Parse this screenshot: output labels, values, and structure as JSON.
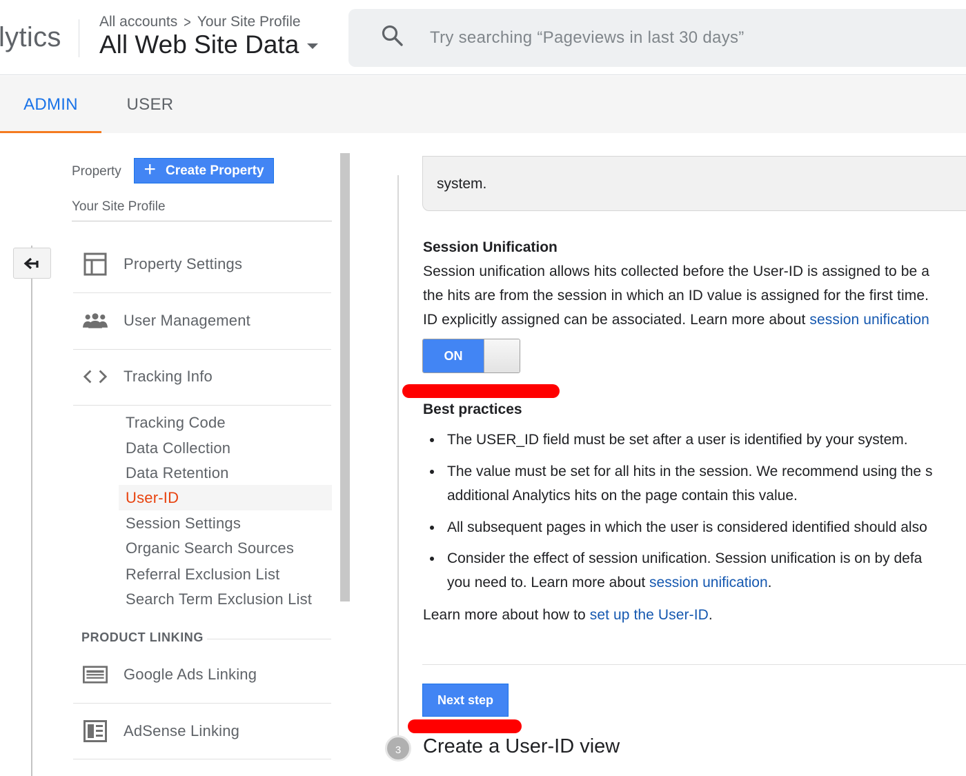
{
  "header": {
    "app_name": "lytics",
    "breadcrumb": {
      "account": "All accounts",
      "separator": ">",
      "property": "Your Site Profile"
    },
    "view_name": "All Web Site Data",
    "search": {
      "placeholder": "Try searching “Pageviews in last 30 days”",
      "value": ""
    }
  },
  "tabs": [
    {
      "label": "ADMIN",
      "active": true
    },
    {
      "label": "USER",
      "active": false
    }
  ],
  "sidebar": {
    "property_label": "Property",
    "create_property_label": "Create Property",
    "property_name": "Your Site Profile",
    "items": [
      {
        "label": "Property Settings",
        "icon": "property-settings-icon"
      },
      {
        "label": "User Management",
        "icon": "people-icon"
      },
      {
        "label": "Tracking Info",
        "icon": "code-brackets-icon"
      }
    ],
    "tracking_subitems": [
      {
        "label": "Tracking Code",
        "active": false
      },
      {
        "label": "Data Collection",
        "active": false
      },
      {
        "label": "Data Retention",
        "active": false
      },
      {
        "label": "User-ID",
        "active": true
      },
      {
        "label": "Session Settings",
        "active": false
      },
      {
        "label": "Organic Search Sources",
        "active": false
      },
      {
        "label": "Referral Exclusion List",
        "active": false
      },
      {
        "label": "Search Term Exclusion List",
        "active": false
      }
    ],
    "product_linking_heading": "PRODUCT LINKING",
    "linking_items": [
      {
        "label": "Google Ads Linking",
        "icon": "google-ads-icon"
      },
      {
        "label": "AdSense Linking",
        "icon": "adsense-icon"
      }
    ]
  },
  "main": {
    "info_box_text": "system.",
    "session_unification": {
      "title": "Session Unification",
      "lines": [
        "Session unification allows hits collected before the User-ID is assigned to be a",
        "the hits are from the session in which an ID value is assigned for the first time."
      ],
      "line3_text": "ID explicitly assigned can be associated. Learn more about ",
      "line3_link": "session unification",
      "toggle_label": "ON",
      "toggle_state": "on"
    },
    "best_practices": {
      "title": "Best practices",
      "bullet1": "The USER_ID field must be set after a user is identified by your system.",
      "bullet2_line1": "The value must be set for all hits in the session. We recommend using the s",
      "bullet2_line2": "additional Analytics hits on the page contain this value.",
      "bullet3": "All subsequent pages in which the user is considered identified should also",
      "bullet4_line1": "Consider the effect of session unification. Session unification is on by defa",
      "bullet4_line2_text": "you need to. Learn more about ",
      "bullet4_line2_link": "session unification",
      "bullet4_line2_end": "."
    },
    "learn_more": {
      "text": "Learn more about how to ",
      "link": "set up the User-ID",
      "end": "."
    },
    "next_step_label": "Next step",
    "step3": {
      "number": "3",
      "title": "Create a User-ID view"
    }
  },
  "colors": {
    "accent_blue": "#4285f4",
    "link_blue": "#1558b0",
    "active_orange": "#e8430f",
    "tab_underline": "#f47b20",
    "annotation_red": "#ff0000"
  }
}
